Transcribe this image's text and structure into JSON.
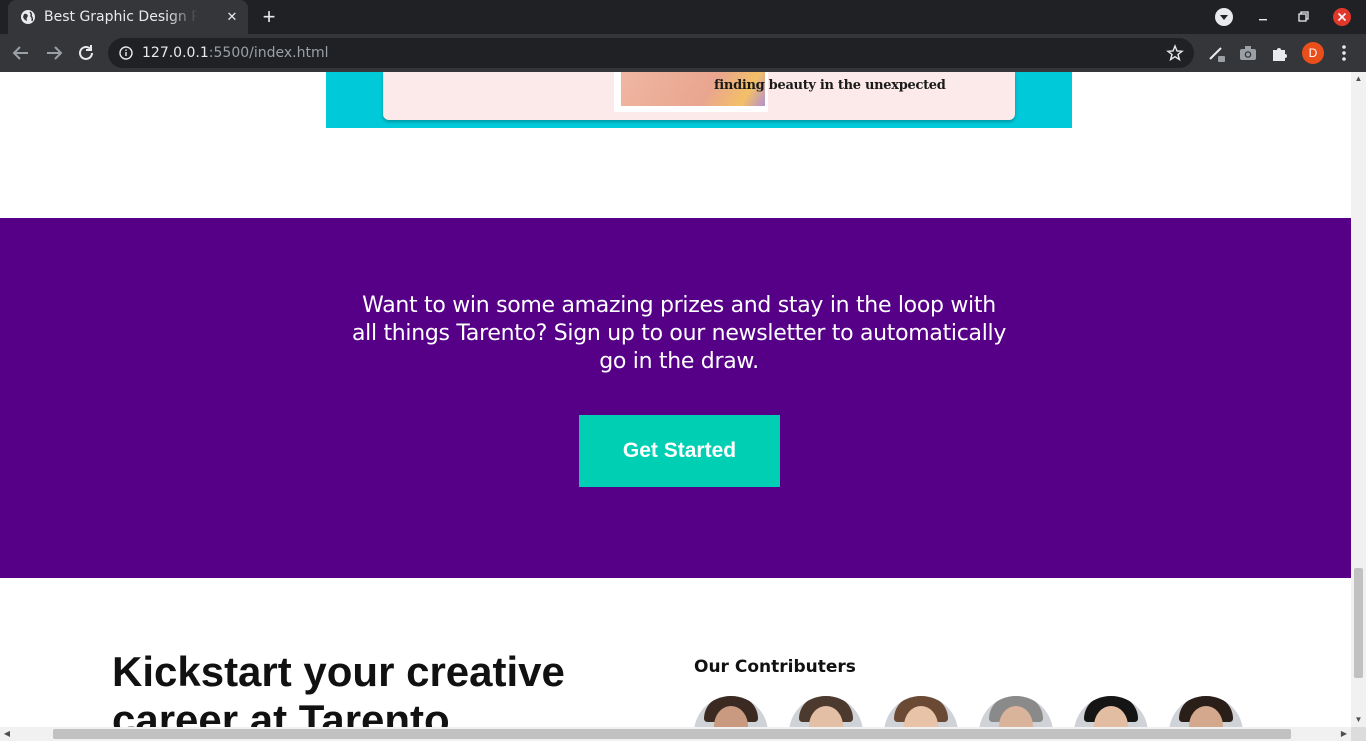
{
  "browser": {
    "tab_title": "Best Graphic Design Portfolio",
    "tab_close": "✕",
    "new_tab": "+",
    "url_host": "127.0.0.1",
    "url_rest": ":5500/index.html",
    "profile_initial": "D"
  },
  "banner": {
    "caption": "finding beauty in the unexpected"
  },
  "newsletter": {
    "text": "Want to win some amazing prizes and stay in the loop with all things Tarento? Sign up to our newsletter to automatically go in the draw.",
    "cta_label": "Get Started"
  },
  "kickstart": {
    "heading": "Kickstart your creative career at Tarento"
  },
  "contributors": {
    "title": "Our Contributers",
    "people": [
      {
        "hair": "#3b2a22",
        "skin": "#c99a80"
      },
      {
        "hair": "#4d3a2e",
        "skin": "#e3bfa6"
      },
      {
        "hair": "#6b4a35",
        "skin": "#e8c3a8"
      },
      {
        "hair": "#8a8a8a",
        "skin": "#d9b49a"
      },
      {
        "hair": "#151515",
        "skin": "#e2bda2"
      },
      {
        "hair": "#2a1e18",
        "skin": "#d4a88c"
      }
    ]
  },
  "colors": {
    "newsletter_bg": "#560088",
    "cta_bg": "#00cfb4",
    "banner_bg": "#00c9d9"
  }
}
